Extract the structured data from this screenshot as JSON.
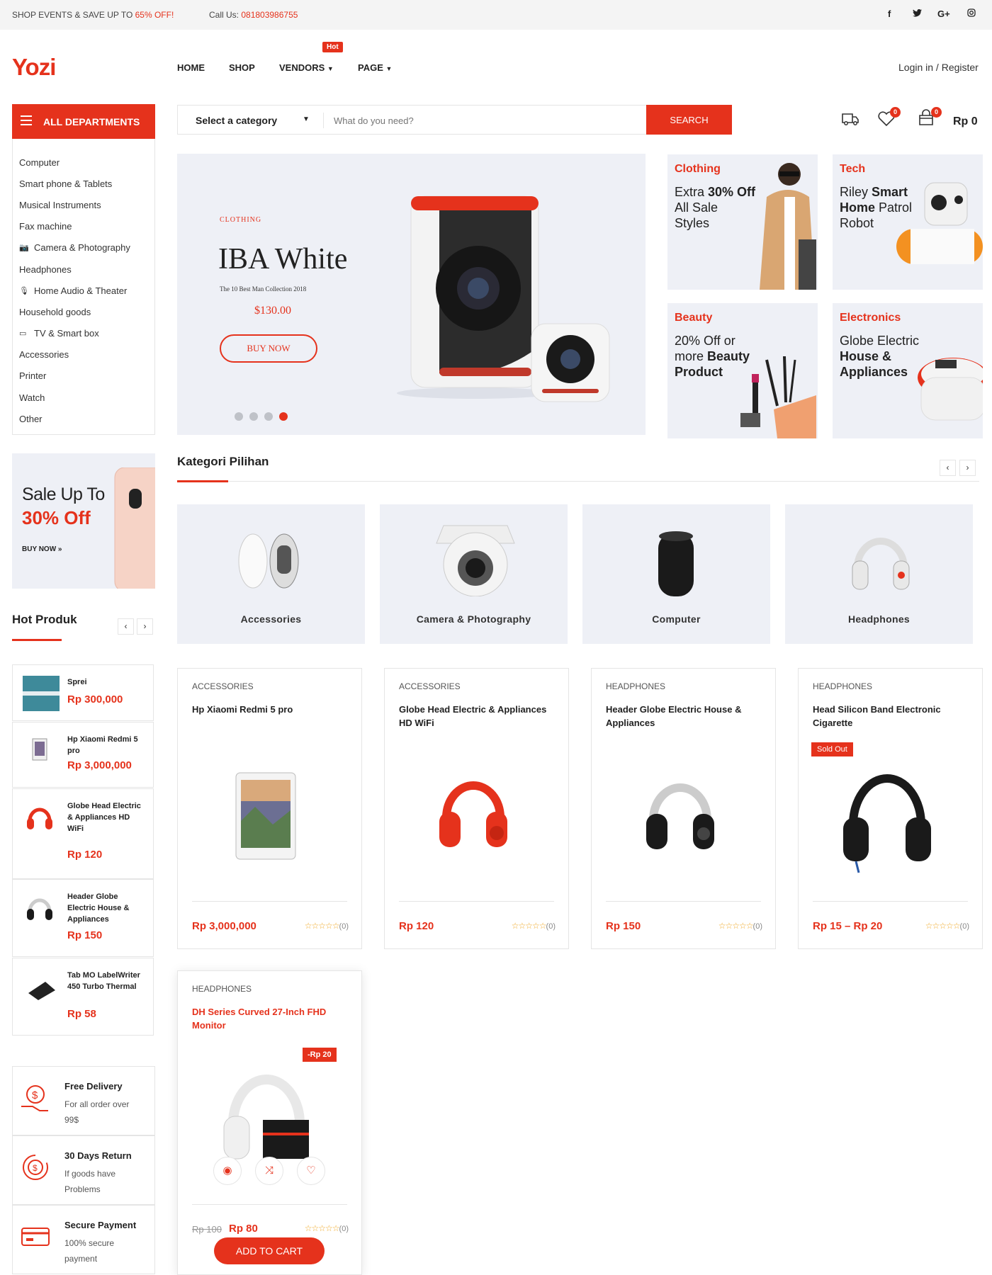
{
  "topbar": {
    "promo_text": "SHOP EVENTS & SAVE UP TO ",
    "promo_pct": "65% OFF!",
    "call_label": "Call Us: ",
    "call_number": "081803986755",
    "social": [
      "f",
      "t",
      "G+",
      "ig"
    ]
  },
  "header": {
    "logo": "Yozi",
    "nav": [
      "HOME",
      "SHOP",
      "VENDORS",
      "PAGE"
    ],
    "hot_badge": "Hot",
    "login": "Login in / Register"
  },
  "departments": {
    "button_label": "ALL DEPARTMENTS",
    "items": [
      {
        "label": "Computer",
        "icon": ""
      },
      {
        "label": "Smart phone & Tablets",
        "icon": ""
      },
      {
        "label": "Musical Instruments",
        "icon": ""
      },
      {
        "label": "Fax machine",
        "icon": ""
      },
      {
        "label": "Camera & Photography",
        "icon": "camera-icon"
      },
      {
        "label": "Headphones",
        "icon": ""
      },
      {
        "label": "Home Audio & Theater",
        "icon": "microphone-icon"
      },
      {
        "label": "Household goods",
        "icon": ""
      },
      {
        "label": "TV & Smart box",
        "icon": "tv-icon"
      },
      {
        "label": "Accessories",
        "icon": ""
      },
      {
        "label": "Printer",
        "icon": ""
      },
      {
        "label": "Watch",
        "icon": ""
      },
      {
        "label": "Other",
        "icon": ""
      }
    ]
  },
  "search": {
    "category_label": "Select a category",
    "placeholder": "What do you need?",
    "button_label": "SEARCH"
  },
  "header_icons": {
    "wishlist_count": "0",
    "cart_count": "0",
    "cart_total": "Rp 0"
  },
  "hero": {
    "eyebrow": "CLOTHING",
    "title": "IBA White",
    "subtitle": "The 10 Best Man Collection 2018",
    "price": "$130.00",
    "button_label": "BUY NOW",
    "dots_total": 4,
    "active_dot": 4
  },
  "promos": [
    {
      "title": "Clothing",
      "pre": "Extra ",
      "bold": "30% Off",
      "post": " All Sale Styles"
    },
    {
      "title": "Tech",
      "pre": "Riley ",
      "bold": "Smart Home",
      "post": " Patrol Robot"
    },
    {
      "title": "Beauty",
      "pre": "20% Off or more ",
      "bold": "Beauty Product",
      "post": ""
    },
    {
      "title": "Electronics",
      "pre": "Globe Electric ",
      "bold": "House & Appliances",
      "post": ""
    }
  ],
  "sale_banner": {
    "line1": "Sale Up To",
    "line2": "30% Off",
    "cta": "BUY NOW »"
  },
  "kategori": {
    "title": "Kategori Pilihan",
    "items": [
      "Accessories",
      "Camera & Photography",
      "Computer",
      "Headphones"
    ]
  },
  "hot_produk": {
    "title": "Hot Produk",
    "items": [
      {
        "name": "Sprei",
        "price": "Rp 300,000"
      },
      {
        "name": "Hp Xiaomi Redmi 5 pro",
        "price": "Rp 3,000,000"
      },
      {
        "name": "Globe Head Electric & Appliances HD WiFi",
        "price": "Rp 120"
      },
      {
        "name": "Header Globe Electric House & Appliances",
        "price": "Rp 150"
      },
      {
        "name": "Tab MO LabelWriter 450 Turbo Thermal",
        "price": "Rp 58"
      }
    ]
  },
  "products": [
    {
      "category": "ACCESSORIES",
      "name": "Hp Xiaomi Redmi 5 pro",
      "price": "Rp 3,000,000",
      "reviews": "(0)"
    },
    {
      "category": "ACCESSORIES",
      "name": "Globe Head Electric & Appliances HD WiFi",
      "price": "Rp 120",
      "reviews": "(0)"
    },
    {
      "category": "HEADPHONES",
      "name": "Header Globe Electric House & Appliances",
      "price": "Rp 150",
      "reviews": "(0)"
    },
    {
      "category": "HEADPHONES",
      "name": "Head Silicon Band Electronic Cigarette",
      "price": "Rp 15 – Rp 20",
      "reviews": "(0)",
      "badge": "Sold Out"
    }
  ],
  "featured_card": {
    "category": "HEADPHONES",
    "name": "DH Series Curved 27-Inch FHD Monitor",
    "discount": "-Rp 20",
    "old_price": "Rp 100",
    "price": "Rp 80",
    "reviews": "(0)",
    "button_label": "ADD TO CART"
  },
  "features": [
    {
      "title": "Free Delivery",
      "desc": "For all order over 99$"
    },
    {
      "title": "30 Days Return",
      "desc": "If goods have Problems"
    },
    {
      "title": "Secure Payment",
      "desc": "100% secure payment"
    }
  ],
  "colors": {
    "accent": "#e5321c",
    "panel": "#eef0f6",
    "star": "#f0a826"
  }
}
